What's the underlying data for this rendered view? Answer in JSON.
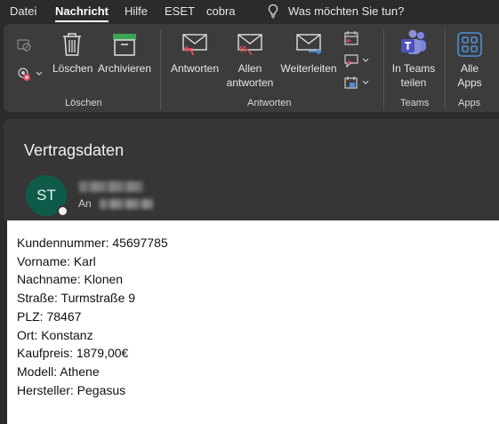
{
  "menu": {
    "items": [
      "Datei",
      "Nachricht",
      "Hilfe",
      "ESET",
      "cobra"
    ],
    "active": "Nachricht",
    "tellme_placeholder": "Was möchten Sie tun?"
  },
  "ribbon": {
    "groups": {
      "loeschen": {
        "label": "Löschen",
        "delete_label": "Löschen",
        "archive_label": "Archivieren"
      },
      "antworten": {
        "label": "Antworten",
        "reply_label": "Antworten",
        "reply_all_line1": "Allen",
        "reply_all_line2": "antworten",
        "forward_label": "Weiterleiten"
      },
      "teams": {
        "label": "Teams",
        "share_line1": "In Teams",
        "share_line2": "teilen"
      },
      "apps": {
        "label": "Apps",
        "all_apps_line1": "Alle",
        "all_apps_line2": "Apps"
      }
    }
  },
  "message": {
    "subject": "Vertragsdaten",
    "avatar_initials": "ST",
    "to_label": "An",
    "body_lines": [
      "Kundennummer: 45697785",
      "Vorname: Karl",
      "Nachname: Klonen",
      "Straße: Turmstraße 9",
      "PLZ: 78467",
      "Ort: Konstanz",
      "Kaufpreis: 1879,00€",
      "Modell: Athene",
      "Hersteller: Pegasus"
    ]
  },
  "colors": {
    "background": "#2b2b2b",
    "ribbon": "#3c3c3c",
    "accent_red": "#d94f5c",
    "accent_green": "#3aa655",
    "accent_blue": "#4f8fd8",
    "teams_purple": "#6264a7",
    "avatar": "#0f5b4a"
  }
}
